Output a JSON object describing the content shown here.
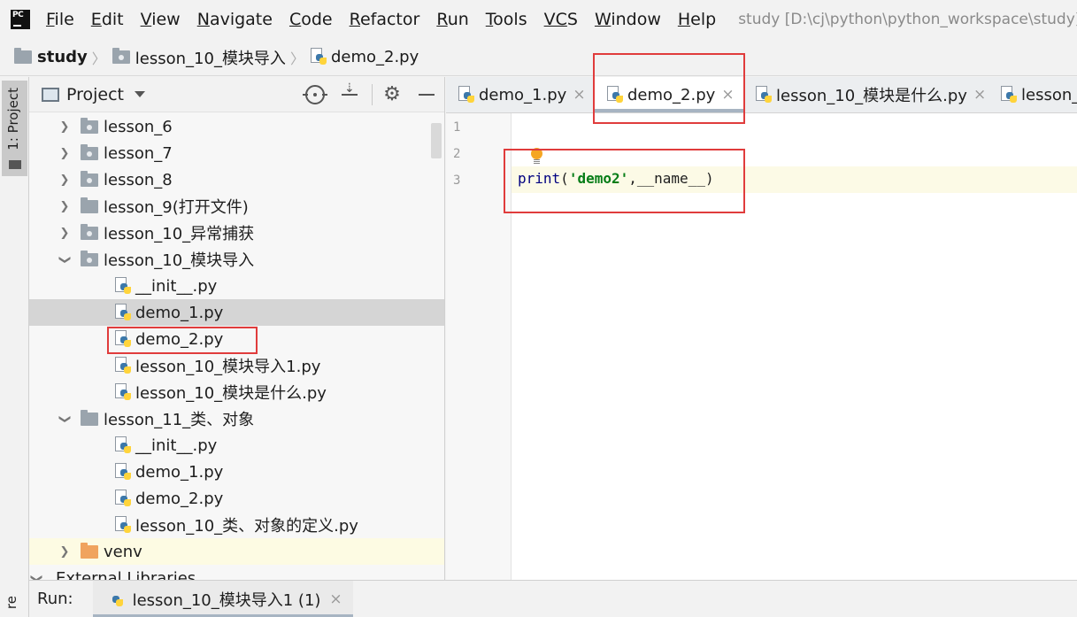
{
  "menu": {
    "items": [
      {
        "mnemonic": "F",
        "rest": "ile"
      },
      {
        "mnemonic": "E",
        "rest": "dit"
      },
      {
        "mnemonic": "V",
        "rest": "iew"
      },
      {
        "mnemonic": "N",
        "rest": "avigate"
      },
      {
        "mnemonic": "C",
        "rest": "ode"
      },
      {
        "mnemonic": "R",
        "rest": "efactor"
      },
      {
        "mnemonic": "R",
        "rest": "un",
        "underline_first": true
      },
      {
        "mnemonic": "T",
        "rest": "ools"
      },
      {
        "mnemonic": "VC",
        "rest": "S"
      },
      {
        "mnemonic": "W",
        "rest": "indow"
      },
      {
        "mnemonic": "H",
        "rest": "elp"
      }
    ],
    "window_title": "study [D:\\cj\\python\\python_workspace\\study] - ...\\"
  },
  "breadcrumb": {
    "items": [
      "study",
      "lesson_10_模块导入",
      "demo_2.py"
    ]
  },
  "left_strip": {
    "project_tab": "1: Project",
    "bottom_tab": "re"
  },
  "project_panel": {
    "title": "Project",
    "tree": [
      {
        "label": "lesson_6",
        "type": "module-folder",
        "depth": 0,
        "expanded": false
      },
      {
        "label": "lesson_7",
        "type": "module-folder",
        "depth": 0,
        "expanded": false
      },
      {
        "label": "lesson_8",
        "type": "module-folder",
        "depth": 0,
        "expanded": false
      },
      {
        "label": "lesson_9(打开文件)",
        "type": "folder",
        "depth": 0,
        "expanded": false
      },
      {
        "label": "lesson_10_异常捕获",
        "type": "module-folder",
        "depth": 0,
        "expanded": false
      },
      {
        "label": "lesson_10_模块导入",
        "type": "module-folder",
        "depth": 0,
        "expanded": true
      },
      {
        "label": "__init__.py",
        "type": "py",
        "depth": 1
      },
      {
        "label": "demo_1.py",
        "type": "py",
        "depth": 1,
        "selected": true
      },
      {
        "label": "demo_2.py",
        "type": "py",
        "depth": 1
      },
      {
        "label": "lesson_10_模块导入1.py",
        "type": "py",
        "depth": 1
      },
      {
        "label": "lesson_10_模块是什么.py",
        "type": "py",
        "depth": 1
      },
      {
        "label": "lesson_11_类、对象",
        "type": "folder",
        "depth": 0,
        "expanded": true
      },
      {
        "label": "__init__.py",
        "type": "py",
        "depth": 1
      },
      {
        "label": "demo_1.py",
        "type": "py",
        "depth": 1
      },
      {
        "label": "demo_2.py",
        "type": "py",
        "depth": 1
      },
      {
        "label": "lesson_10_类、对象的定义.py",
        "type": "py",
        "depth": 1
      },
      {
        "label": "venv",
        "type": "venv-folder",
        "depth": 0,
        "expanded": false
      },
      {
        "label": "External Libraries",
        "type": "libraries",
        "depth": 0,
        "expanded": true
      }
    ]
  },
  "editor": {
    "tabs": [
      {
        "label": "demo_1.py",
        "active": false
      },
      {
        "label": "demo_2.py",
        "active": true
      },
      {
        "label": "lesson_10_模块是什么.py",
        "active": false
      },
      {
        "label": "lesson_",
        "active": false
      }
    ],
    "line_numbers": [
      "1",
      "2",
      "3"
    ],
    "code": {
      "fn": "print",
      "open": "(",
      "string": "'demo2'",
      "rest": ",__name__)"
    }
  },
  "run_bar": {
    "label": "Run:",
    "tab_label": "lesson_10_模块导入1 (1)"
  },
  "colors": {
    "highlight_box": "#e03c3c",
    "selection": "#d5d5d5",
    "current_line": "#fcfae6",
    "string": "#067d17"
  },
  "icons": {
    "close": "×",
    "gear": "⚙"
  }
}
